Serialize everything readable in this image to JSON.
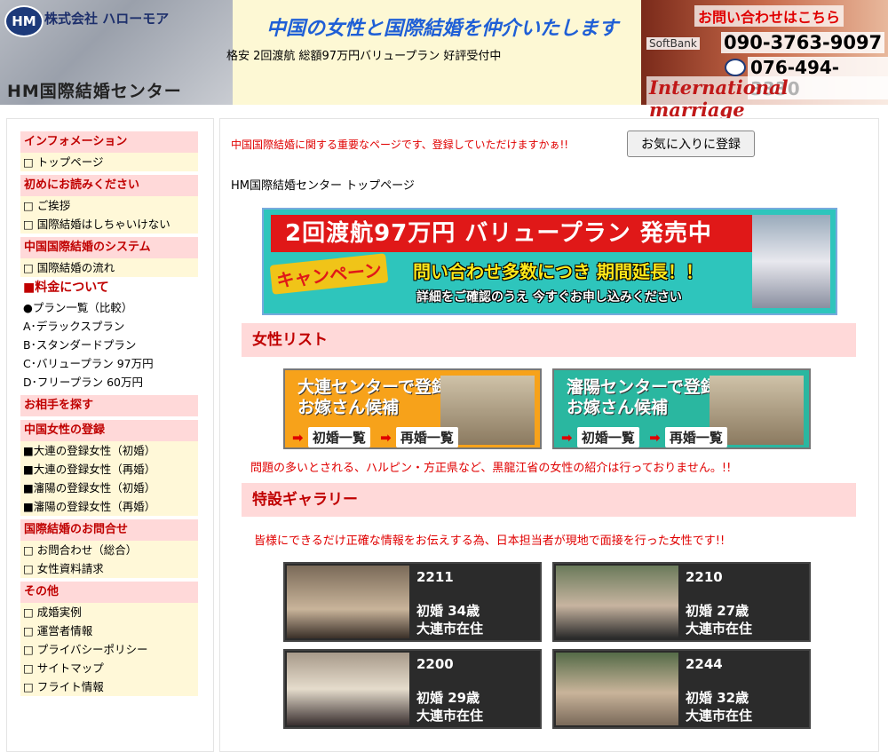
{
  "header": {
    "logo_mark": "HM",
    "company": "株式会社 ハローモア",
    "center_name": "HM国際結婚センター",
    "catchphrase": "中国の女性と国際結婚を仲介いたします",
    "sub_catch": "格安 2回渡航 総額97万円バリュープラン 好評受付中",
    "contact_label": "お問い合わせはこちら",
    "softbank_label": "SoftBank",
    "tel_mobile": "090-3763-9097",
    "tel_landline": "076-494-3330",
    "tagline": "International marriage"
  },
  "sidebar": {
    "sections": [
      {
        "title": "インフォメーション",
        "items": [
          "□ トップページ"
        ]
      },
      {
        "title": "初めにお読みください",
        "items": [
          "□ ご挨拶",
          "□ 国際結婚はしちゃいけない"
        ]
      },
      {
        "title": "中国国際結婚のシステム",
        "items": [
          "□ 国際結婚の流れ"
        ]
      }
    ],
    "fee_heading": "■料金について",
    "fee_items": [
      "●プラン一覧（比較）",
      "A･デラックスプラン",
      "B･スタンダードプラン",
      "C･バリュープラン 97万円",
      "D･フリープラン 60万円"
    ],
    "sections2": [
      {
        "title": "お相手を探す",
        "items": []
      },
      {
        "title": "中国女性の登録",
        "items": [
          "■大連の登録女性（初婚）",
          "■大連の登録女性（再婚）",
          "■瀋陽の登録女性（初婚）",
          "■瀋陽の登録女性（再婚）"
        ]
      },
      {
        "title": "国際結婚のお問合せ",
        "items": [
          "□ お問合わせ（総合）",
          "□ 女性資料請求"
        ]
      },
      {
        "title": "その他",
        "items": [
          "□ 成婚実例",
          "□ 運営者情報",
          "□ プライバシーポリシー",
          "□ サイトマップ",
          "□ フライト情報"
        ]
      }
    ]
  },
  "main": {
    "notice": "中国国際結婚に関する重要なページです、登録していただけますかぁ!!",
    "fav_button": "お気に入りに登録",
    "page_title": "HM国際結婚センター トップページ",
    "banner": {
      "headline": "2回渡航97万円 バリュープラン 発売中",
      "campaign": "キャンペーン",
      "extension": "問い合わせ多数につき 期間延長！！",
      "detail": "詳細をご確認のうえ 今すぐお申し込みください"
    },
    "women_list_title": "女性リスト",
    "centers": [
      {
        "title_line1": "大連センターで登録の",
        "title_line2": "お嫁さん候補",
        "btn_first": "初婚一覧",
        "btn_re": "再婚一覧"
      },
      {
        "title_line1": "瀋陽センターで登録の",
        "title_line2": "お嫁さん候補",
        "btn_first": "初婚一覧",
        "btn_re": "再婚一覧"
      }
    ],
    "warning": "問題の多いとされる、ハルピン・方正県など、黒龍江省の女性の紹介は行っておりません。!!",
    "gallery_title": "特設ギャラリー",
    "gallery_note": "皆様にできるだけ正確な情報をお伝えする為、日本担当者が現地で面接を行った女性です!!",
    "profiles": [
      {
        "id": "2211",
        "age": "初婚 34歳",
        "location": "大連市在住"
      },
      {
        "id": "2210",
        "age": "初婚 27歳",
        "location": "大連市在住"
      },
      {
        "id": "2200",
        "age": "初婚 29歳",
        "location": "大連市在住"
      },
      {
        "id": "2244",
        "age": "初婚 32歳",
        "location": "大連市在住"
      }
    ]
  }
}
